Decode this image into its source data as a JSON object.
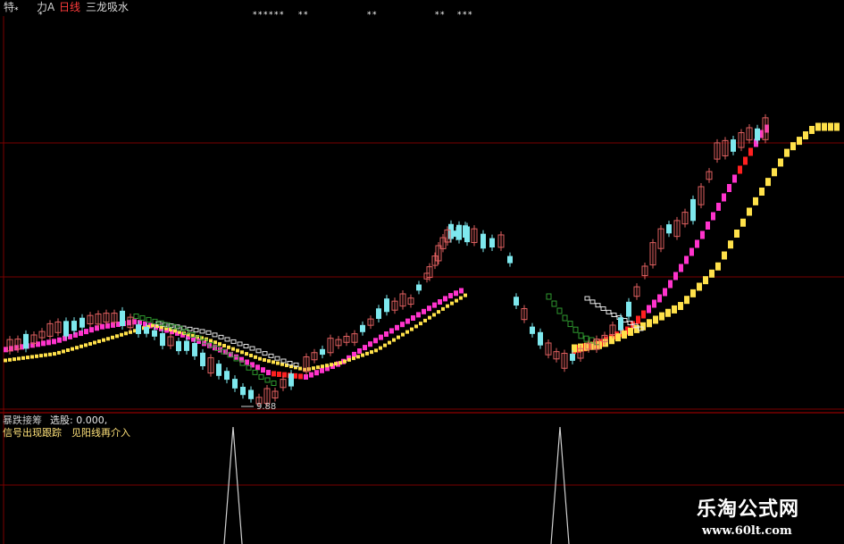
{
  "top_bar": {
    "tag1": "特",
    "tag2": "力A",
    "period": "日线",
    "indicator_name": "三龙吸水"
  },
  "price_panel": {
    "min_price_label": "9.88"
  },
  "sub_panel": {
    "title": "暴跌接筹",
    "select_label": "选股: 0.000,",
    "signal_text": "信号出现跟踪",
    "signal_text_2": "见阳线再介入"
  },
  "watermark": {
    "name": "乐淘公式网",
    "url": "www.60lt.com"
  },
  "colors": {
    "up_candle": "#e06060",
    "down_candle": "#7ee8ee",
    "line_yellow": "#ffe14a",
    "line_magenta": "#ff33cc",
    "line_red": "#ff2020",
    "line_white": "#e6e6e6",
    "line_green": "#2f9a2f",
    "grid": "#7a0000",
    "signal": "#d0d0d0"
  },
  "chart_data": {
    "type": "candlestick",
    "series": [],
    "signals": [
      {
        "kind": "bottom-spike",
        "position": "left"
      },
      {
        "kind": "bottom-spike",
        "position": "right"
      }
    ]
  }
}
